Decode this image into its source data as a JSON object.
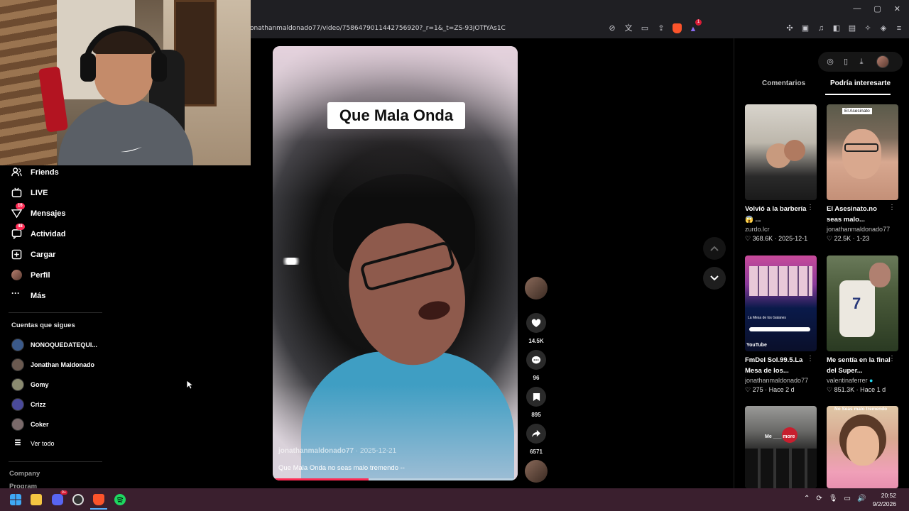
{
  "browser": {
    "url": "onathanmaldonado77/video/7586479011442756920?_r=1&_t=ZS-93jOTfYAs1C",
    "brave_badge": "1",
    "window_controls": [
      "—",
      "▢",
      "✕"
    ]
  },
  "sidebar": {
    "nav": [
      {
        "label": "Friends",
        "icon": "friends-icon",
        "badge": ""
      },
      {
        "label": "LIVE",
        "icon": "live-icon",
        "badge": ""
      },
      {
        "label": "Mensajes",
        "icon": "messages-icon",
        "badge": "16"
      },
      {
        "label": "Actividad",
        "icon": "activity-icon",
        "badge": "48"
      },
      {
        "label": "Cargar",
        "icon": "upload-icon",
        "badge": ""
      },
      {
        "label": "Perfil",
        "icon": "profile-avatar",
        "badge": ""
      },
      {
        "label": "Más",
        "icon": "more-icon",
        "badge": ""
      }
    ],
    "following_title": "Cuentas que sigues",
    "following": [
      {
        "name": "NONOQUEDATEQUI...",
        "color": "#3b5a8a"
      },
      {
        "name": "Jonathan Maldonado",
        "color": "#6b5a50"
      },
      {
        "name": "Gomy",
        "color": "#8a8a70"
      },
      {
        "name": "Crizz",
        "color": "#4a4a9a"
      },
      {
        "name": "Coker",
        "color": "#7a6a6a"
      }
    ],
    "see_all": "Ver todo",
    "footer": [
      "Company",
      "Program"
    ]
  },
  "video": {
    "caption": "Que Mala Onda",
    "author": "jonathanmaldonado77",
    "date": "2025-12-21",
    "description": "Que Mala Onda no seas malo tremendo --",
    "progress": 0.39
  },
  "actions": {
    "likes": "14.5K",
    "comments": "96",
    "saves": "895",
    "shares": "6571"
  },
  "right_panel": {
    "tabs": [
      "Comentarios",
      "Podría interesarte"
    ],
    "active_tab": 1,
    "cards": [
      {
        "title": "Volvió a la barbería 😱 ...",
        "author": "zurdo.lcr",
        "likes": "368.6K",
        "date": "2025-12-1",
        "tag": "",
        "colors": [
          "#cfcac2",
          "#2a2a2a"
        ]
      },
      {
        "title": "El Asesinato.no seas malo...",
        "author": "jonathanmaldonado77",
        "likes": "22.5K",
        "date": "1-23",
        "tag": "El Asesinato",
        "colors": [
          "#6a6a5a",
          "#d8a890"
        ]
      },
      {
        "title": "FmDel Sol.99.5.La Mesa de los...",
        "author": "jonathanmaldonado77",
        "likes": "275",
        "date": "Hace 2 d",
        "tag": "",
        "colors": [
          "#d04a9a",
          "#0a1a4a"
        ]
      },
      {
        "title": "Me sentía en la final del Super...",
        "author": "valentinaferrer",
        "likes": "851.3K",
        "date": "Hace 1 d",
        "tag": "",
        "colors": [
          "#5a6a4a",
          "#e8e4dc"
        ]
      },
      {
        "title": "",
        "author": "",
        "likes": "",
        "date": "",
        "tag": "",
        "colors": [
          "#8a8a88",
          "#1a1a1a"
        ]
      },
      {
        "title": "",
        "author": "",
        "likes": "",
        "date": "",
        "tag": "No Seas malo tremendo",
        "colors": [
          "#f0a0b8",
          "#c87a5a"
        ]
      }
    ],
    "thumb_text": {
      "mesa": "La Mesa de los Galanes",
      "youtube": "YouTube",
      "moto": "Me ___ more"
    }
  },
  "taskbar": {
    "time": "20:52",
    "date": "9/2/2026",
    "discord_badge": "9+"
  }
}
